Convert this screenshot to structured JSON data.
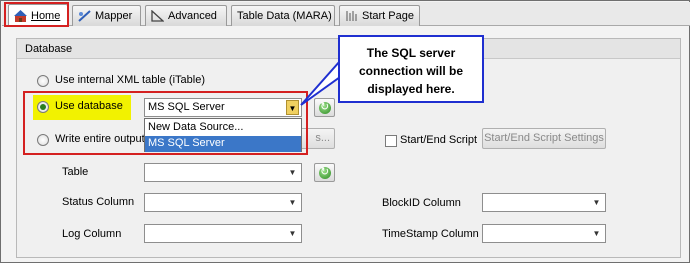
{
  "tabs": [
    {
      "label": "Home",
      "icon": "home-icon"
    },
    {
      "label": "Mapper",
      "icon": "mapper-icon"
    },
    {
      "label": "Advanced",
      "icon": "advanced-icon"
    },
    {
      "label": "Table Data (MARA)",
      "icon": ""
    },
    {
      "label": "Start Page",
      "icon": "start-page-icon"
    }
  ],
  "panel": {
    "title": "Database",
    "option_xml": "Use internal XML table (iTable)",
    "option_db": "Use  database",
    "option_write": "Write entire output",
    "db_combo_value": "MS SQL Server",
    "settings_button_fragment": "s...",
    "start_end_script_label": "Start/End Script",
    "start_end_settings_button": "Start/End Script Settings",
    "table_label": "Table",
    "status_column_label": "Status Column",
    "log_column_label": "Log Column",
    "blockid_column_label": "BlockID Column",
    "timestamp_column_label": "TimeStamp Column"
  },
  "dropdown": {
    "items": [
      "New Data Source...",
      "MS SQL Server"
    ],
    "selected_index": 1
  },
  "callout": {
    "text": "The SQL server connection will be displayed here."
  },
  "colors": {
    "highlight_yellow": "#f2f200",
    "annotation_red": "#d42020",
    "callout_blue": "#1f2fd0",
    "selection_blue": "#3b77c8"
  }
}
